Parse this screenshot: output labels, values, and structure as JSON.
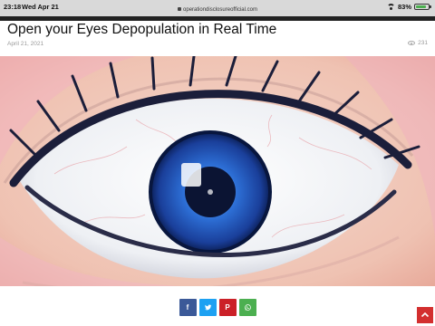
{
  "status_bar": {
    "time": "23:18",
    "date": "Wed Apr 21",
    "url": "operationdisclosureofficial.com",
    "battery": "83%",
    "battery_level_percent": 83
  },
  "article": {
    "title": "Open your Eyes Depopulation in Real Time",
    "date": "April 21, 2021",
    "views": "231",
    "hero_image_icon": "eye-illustration"
  },
  "share": {
    "buttons": [
      {
        "network": "facebook",
        "glyph": "f",
        "color": "#3b5998"
      },
      {
        "network": "twitter",
        "icon": "twitter-bird-icon",
        "color": "#1da1f2"
      },
      {
        "network": "pinterest",
        "glyph": "P",
        "color": "#cb2027"
      },
      {
        "network": "whatsapp",
        "icon": "whatsapp-icon",
        "color": "#4caf50"
      }
    ]
  },
  "colors": {
    "topbar": "#222222",
    "scroll_top": "#d32f2f",
    "iris": "#1f5cc4"
  },
  "scroll_top_icon": "chevron-up-icon"
}
